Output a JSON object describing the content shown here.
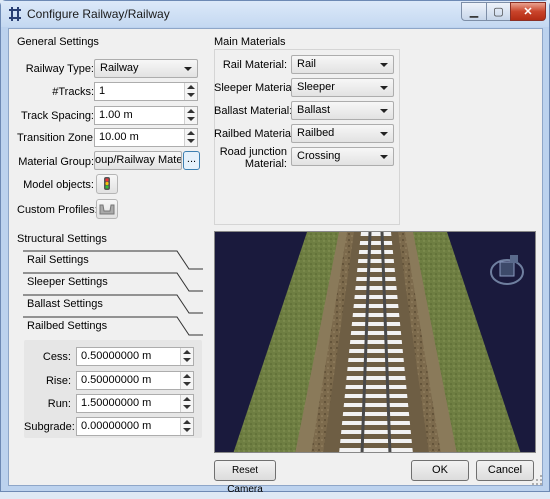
{
  "window": {
    "title": "Configure Railway/Railway"
  },
  "general": {
    "heading": "General Settings",
    "railway_type": {
      "label": "Railway Type:",
      "value": "Railway"
    },
    "tracks": {
      "label": "#Tracks:",
      "value": "1"
    },
    "track_spacing": {
      "label": "Track Spacing:",
      "value": "1.00 m"
    },
    "transition_zone": {
      "label": "Transition Zone:",
      "value": "10.00 m"
    },
    "material_group": {
      "label": "Material Group:",
      "value": "oup/Railway Materials",
      "browse": "..."
    },
    "model_objects": {
      "label": "Model objects:"
    },
    "custom_profiles": {
      "label": "Custom Profiles:"
    }
  },
  "materials": {
    "heading": "Main Materials",
    "rail": {
      "label": "Rail Material:",
      "value": "Rail"
    },
    "sleeper": {
      "label": "Sleeper Material:",
      "value": "Sleeper"
    },
    "ballast": {
      "label": "Ballast Material:",
      "value": "Ballast"
    },
    "railbed": {
      "label": "Railbed Material:",
      "value": "Railbed"
    },
    "road_junction": {
      "label_line1": "Road junction",
      "label_line2": "Material:",
      "value": "Crossing"
    }
  },
  "structural": {
    "heading": "Structural Settings",
    "tabs": [
      "Rail Settings",
      "Sleeper Settings",
      "Ballast Settings",
      "Railbed Settings"
    ],
    "cess": {
      "label": "Cess:",
      "value": "0.50000000 m"
    },
    "rise": {
      "label": "Rise:",
      "value": "0.50000000 m"
    },
    "run": {
      "label": "Run:",
      "value": "1.50000000 m"
    },
    "subgrade": {
      "label": "Subgrade:",
      "value": "0.00000000 m"
    }
  },
  "buttons": {
    "reset_camera": "Reset Camera",
    "ok": "OK",
    "cancel": "Cancel"
  },
  "colors": {
    "accent_red": "#c9442b",
    "grass": "#6b7a3d",
    "ballast": "#7a6a4e",
    "sky": "#1a1a3d"
  }
}
